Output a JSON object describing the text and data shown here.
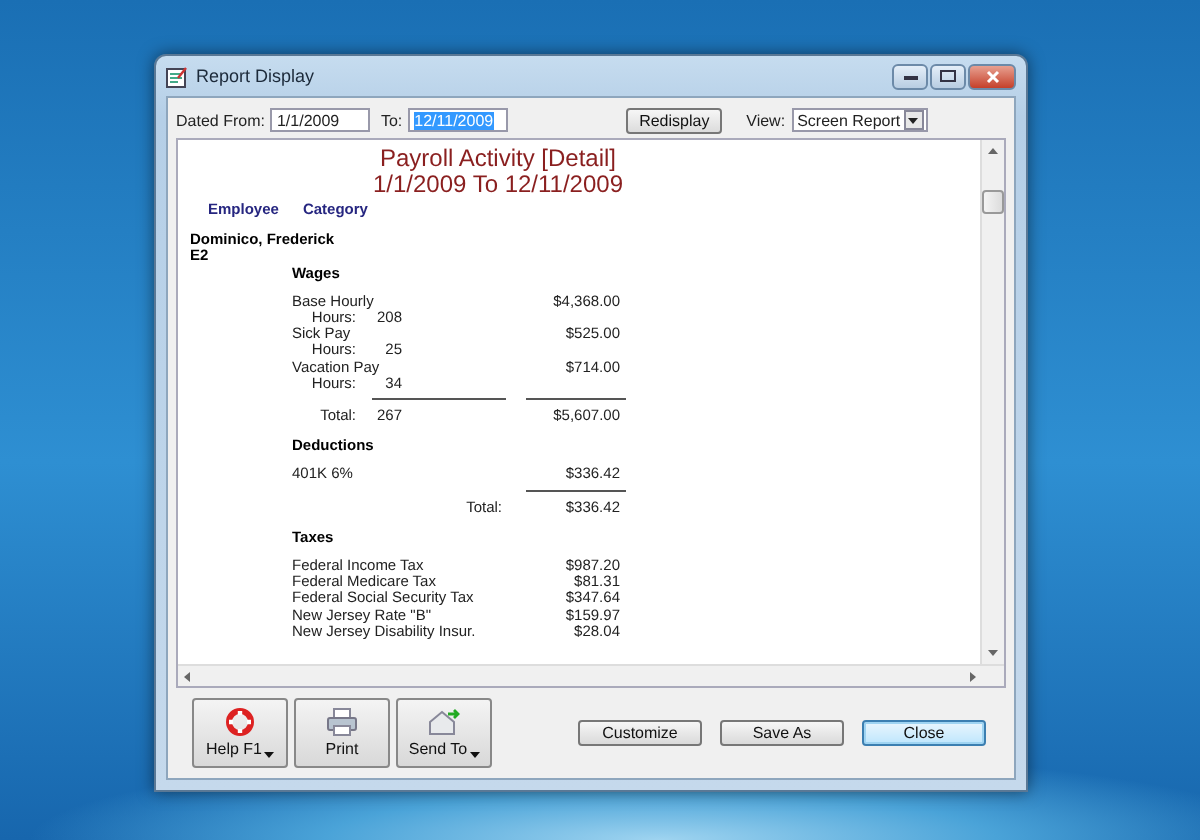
{
  "window": {
    "title": "Report Display"
  },
  "toolbar": {
    "from_label": "Dated From:",
    "from_value": "1/1/2009",
    "to_label": "To:",
    "to_value": "12/11/2009",
    "to_value_highlighted": true,
    "redisplay_button": "Redisplay",
    "view_label": "View:",
    "view_value": "Screen Report"
  },
  "report": {
    "title": "Payroll Activity [Detail]",
    "date_range": "1/1/2009 To 12/11/2009",
    "columns": [
      "Employee",
      "Category"
    ],
    "employee": {
      "name": "Dominico, Frederick",
      "code": "E2"
    },
    "sections": [
      {
        "heading": "Wages",
        "items": [
          {
            "name": "Base Hourly",
            "hours_label": "Hours:",
            "hours": "208",
            "amount": "$4,368.00"
          },
          {
            "name": "Sick Pay",
            "hours_label": "Hours:",
            "hours": "25",
            "amount": "$525.00"
          },
          {
            "name": "Vacation Pay",
            "hours_label": "Hours:",
            "hours": "34",
            "amount": "$714.00"
          }
        ],
        "total": {
          "label": "Total:",
          "hours": "267",
          "amount": "$5,607.00"
        }
      },
      {
        "heading": "Deductions",
        "items": [
          {
            "name": "401K 6%",
            "amount": "$336.42"
          }
        ],
        "total": {
          "label": "Total:",
          "amount": "$336.42"
        }
      },
      {
        "heading": "Taxes",
        "items": [
          {
            "name": "Federal Income Tax",
            "amount": "$987.20"
          },
          {
            "name": "Federal Medicare Tax",
            "amount": "$81.31"
          },
          {
            "name": "Federal Social Security Tax",
            "amount": "$347.64"
          },
          {
            "name": "New Jersey Rate \"B\"",
            "amount": "$159.97"
          },
          {
            "name": "New Jersey Disability Insur.",
            "amount": "$28.04"
          }
        ]
      }
    ]
  },
  "tool_buttons": [
    {
      "label": "Help F1",
      "kind": "help",
      "dropdown": true
    },
    {
      "label": "Print",
      "kind": "print",
      "dropdown": false
    },
    {
      "label": "Send To",
      "kind": "send",
      "dropdown": true
    }
  ],
  "dialog_buttons": [
    {
      "label": "Customize",
      "default": false
    },
    {
      "label": "Save As",
      "default": false
    },
    {
      "label": "Close",
      "default": true
    }
  ]
}
